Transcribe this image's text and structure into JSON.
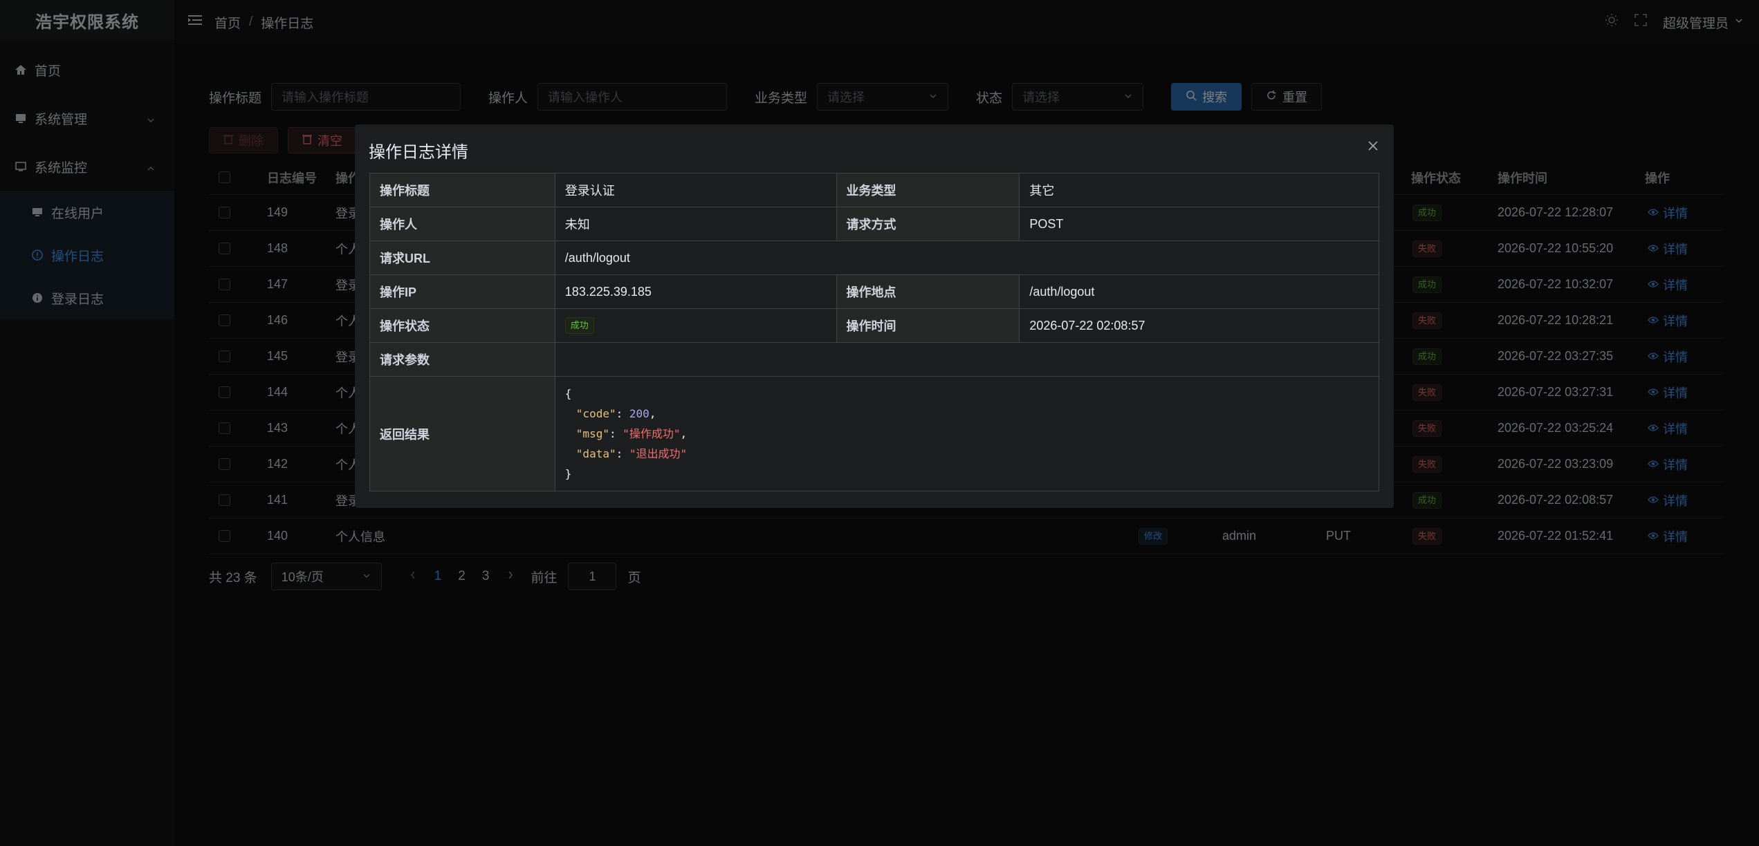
{
  "app": {
    "title": "浩宇权限系统"
  },
  "sidebar": {
    "items": [
      {
        "label": "首页",
        "icon": "home-icon"
      },
      {
        "label": "系统管理",
        "icon": "monitor-icon"
      },
      {
        "label": "系统监控",
        "icon": "screen-icon"
      }
    ],
    "sub_items": [
      {
        "label": "在线用户",
        "icon": "user-monitor-icon"
      },
      {
        "label": "操作日志",
        "icon": "info-circle-icon"
      },
      {
        "label": "登录日志",
        "icon": "info-filled-icon"
      }
    ]
  },
  "header": {
    "breadcrumb": [
      "首页",
      "操作日志"
    ],
    "user": "超级管理员"
  },
  "search": {
    "title_label": "操作标题",
    "title_placeholder": "请输入操作标题",
    "operator_label": "操作人",
    "operator_placeholder": "请输入操作人",
    "biztype_label": "业务类型",
    "biztype_placeholder": "请选择",
    "status_label": "状态",
    "status_placeholder": "请选择",
    "search_btn": "搜索",
    "reset_btn": "重置"
  },
  "toolbar": {
    "delete": "删除",
    "clear": "清空"
  },
  "table": {
    "headers": {
      "id": "日志编号",
      "title": "操作",
      "status": "操作状态",
      "time": "操作时间",
      "action": "操作"
    },
    "rows": [
      {
        "id": "149",
        "title": "登录",
        "status": "成功",
        "time": "2026-07-22 12:28:07",
        "action": "详情"
      },
      {
        "id": "148",
        "title": "个人",
        "status": "失败",
        "time": "2026-07-22 10:55:20",
        "action": "详情"
      },
      {
        "id": "147",
        "title": "登录",
        "status": "成功",
        "time": "2026-07-22 10:32:07",
        "action": "详情"
      },
      {
        "id": "146",
        "title": "个人",
        "status": "失败",
        "time": "2026-07-22 10:28:21",
        "action": "详情"
      },
      {
        "id": "145",
        "title": "登录",
        "status": "成功",
        "time": "2026-07-22 03:27:35",
        "action": "详情"
      },
      {
        "id": "144",
        "title": "个人",
        "status": "失败",
        "time": "2026-07-22 03:27:31",
        "action": "详情"
      },
      {
        "id": "143",
        "title": "个人",
        "status": "失败",
        "time": "2026-07-22 03:25:24",
        "action": "详情"
      },
      {
        "id": "142",
        "title": "个人",
        "status": "失败",
        "time": "2026-07-22 03:23:09",
        "action": "详情"
      },
      {
        "id": "141",
        "title": "登录",
        "status": "成功",
        "time": "2026-07-22 02:08:57",
        "action": "详情"
      }
    ],
    "last_row": {
      "id": "140",
      "title": "个人信息",
      "biztype": "修改",
      "operator": "admin",
      "method": "PUT",
      "status": "失败",
      "time": "2026-07-22 01:52:41",
      "action": "详情"
    }
  },
  "pagination": {
    "total": "共 23 条",
    "page_size": "10条/页",
    "pages": [
      "1",
      "2",
      "3"
    ],
    "goto_label": "前往",
    "goto_value": "1",
    "page_suffix": "页"
  },
  "dialog": {
    "title": "操作日志详情",
    "labels": {
      "title": "操作标题",
      "biztype": "业务类型",
      "operator": "操作人",
      "method": "请求方式",
      "url": "请求URL",
      "ip": "操作IP",
      "location": "操作地点",
      "status": "操作状态",
      "time": "操作时间",
      "params": "请求参数",
      "result": "返回结果"
    },
    "values": {
      "title": "登录认证",
      "biztype": "其它",
      "operator": "未知",
      "method": "POST",
      "url": "/auth/logout",
      "ip": "183.225.39.185",
      "location": "/auth/logout",
      "status": "成功",
      "time": "2026-07-22 02:08:57",
      "params": ""
    },
    "result": {
      "open": "{",
      "code_key": "\"code\"",
      "code_val": "200",
      "msg_key": "\"msg\"",
      "msg_val": "\"操作成功\"",
      "data_key": "\"data\"",
      "data_val": "\"退出成功\"",
      "close": "}"
    }
  },
  "colors": {
    "primary": "#409eff",
    "success": "#67c23a",
    "danger": "#f56c6c"
  }
}
